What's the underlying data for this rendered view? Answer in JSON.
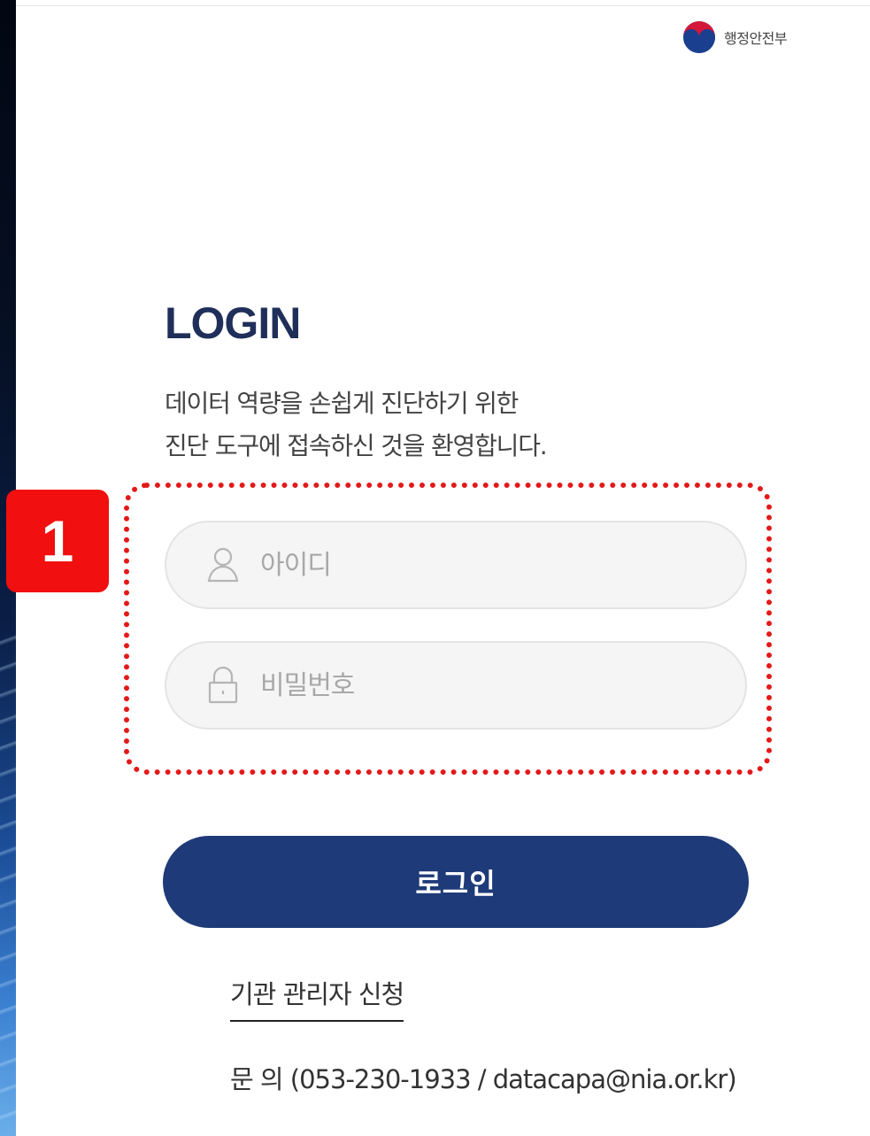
{
  "header": {
    "ministry_name": "행정안전부",
    "logo_icon": "korea-taegeuk-logo-icon"
  },
  "login": {
    "title": "LOGIN",
    "welcome_line1": "데이터 역량을 손쉽게 진단하기 위한",
    "welcome_line2": "진단 도구에 접속하신 것을 환영합니다.",
    "id_placeholder": "아이디",
    "id_icon": "user-icon",
    "password_placeholder": "비밀번호",
    "password_icon": "lock-icon",
    "submit_label": "로그인",
    "admin_apply_link": "기관 관리자 신청",
    "contact": "문 의 (053-230-1933 / datacapa@nia.or.kr)"
  },
  "annotation": {
    "step_number": "1",
    "highlight_color": "#e31919",
    "badge_color": "#f10f0f"
  },
  "colors": {
    "title": "#1f2f5a",
    "button": "#1e3a78",
    "field_bg": "#f5f5f5"
  }
}
